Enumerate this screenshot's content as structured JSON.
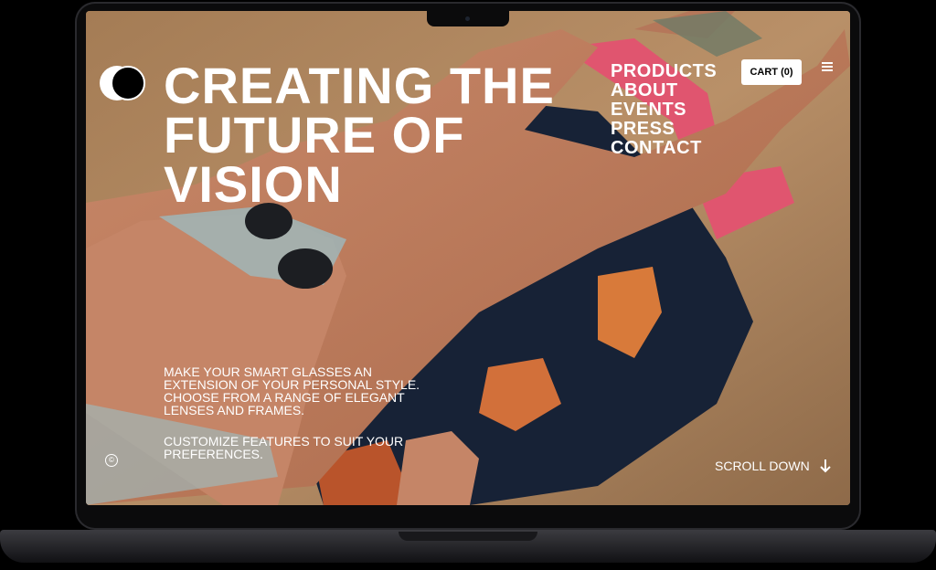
{
  "site": {
    "headline_lines": [
      "CREATING THE",
      "FUTURE OF",
      "VISION"
    ],
    "nav": [
      "PRODUCTS",
      "ABOUT",
      "EVENTS",
      "PRESS",
      "CONTACT"
    ],
    "cart_label": "CART (0)",
    "description": [
      "MAKE YOUR SMART GLASSES AN EXTENSION OF YOUR PERSONAL STYLE. CHOOSE FROM A RANGE OF ELEGANT LENSES AND FRAMES.",
      "CUSTOMIZE FEATURES TO SUIT YOUR PREFERENCES."
    ],
    "copyright_symbol": "©",
    "scroll_label": "SCROLL DOWN"
  },
  "icons": [
    "logo-icon",
    "menu-icon",
    "arrow-down-icon",
    "copyright-icon"
  ],
  "colors": {
    "text": "#ffffff",
    "cart_bg": "#ffffff",
    "frame": "#0b0b0c"
  }
}
